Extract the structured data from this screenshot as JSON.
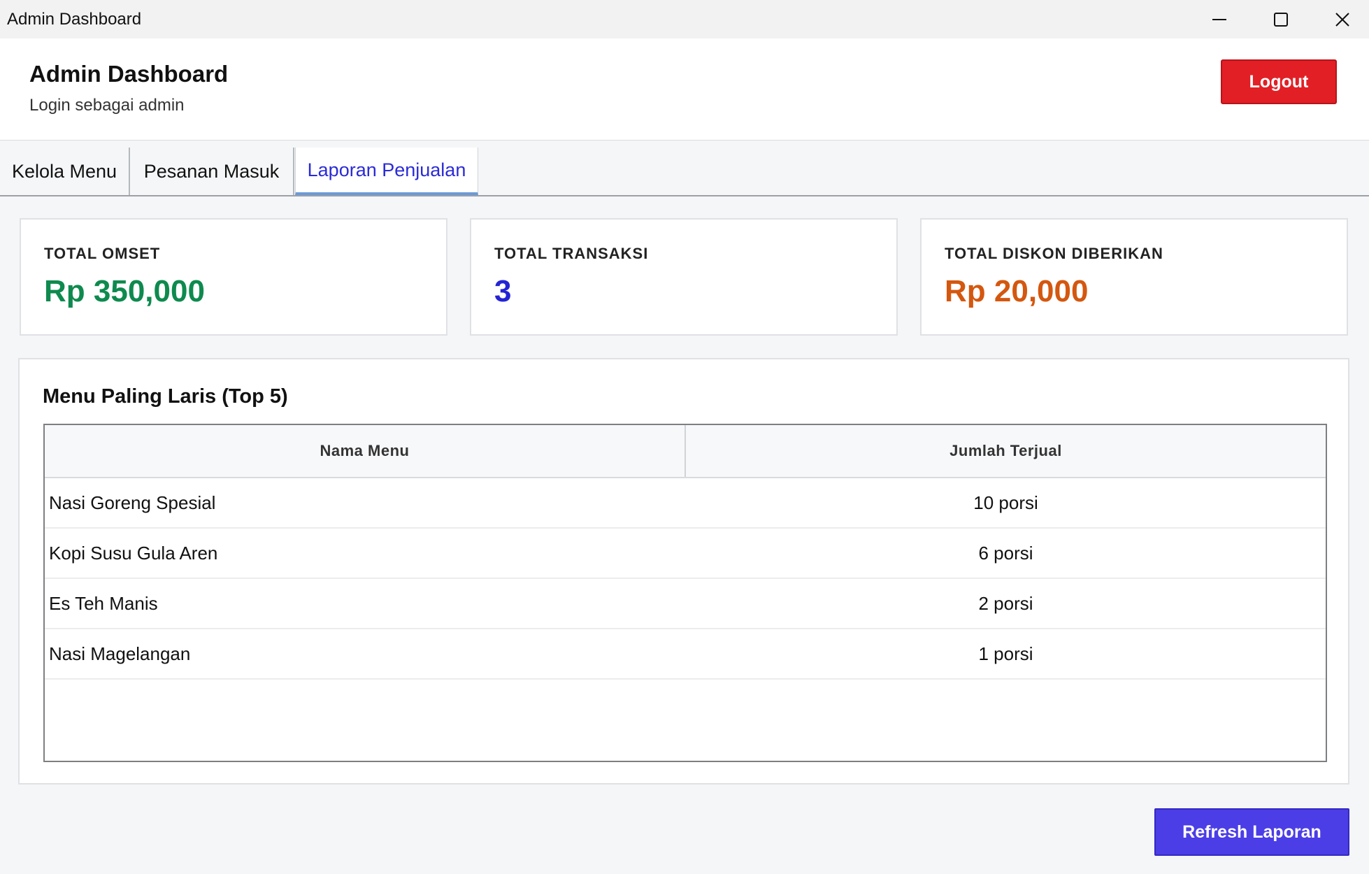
{
  "window": {
    "title": "Admin Dashboard"
  },
  "header": {
    "title": "Admin Dashboard",
    "subtitle": "Login sebagai admin",
    "logout_label": "Logout"
  },
  "tabs": [
    {
      "label": "Kelola Menu",
      "active": false
    },
    {
      "label": "Pesanan Masuk",
      "active": false
    },
    {
      "label": "Laporan Penjualan",
      "active": true
    }
  ],
  "stats": [
    {
      "label": "TOTAL OMSET",
      "value": "Rp 350,000",
      "color": "#0e8a4e"
    },
    {
      "label": "TOTAL TRANSAKSI",
      "value": "3",
      "color": "#2424d4"
    },
    {
      "label": "TOTAL DISKON DIBERIKAN",
      "value": "Rp 20,000",
      "color": "#d4570f"
    }
  ],
  "top_menu": {
    "title": "Menu Paling Laris (Top 5)",
    "columns": [
      "Nama Menu",
      "Jumlah Terjual"
    ],
    "rows": [
      {
        "name": "Nasi Goreng Spesial",
        "qty": "10 porsi"
      },
      {
        "name": "Kopi Susu Gula Aren",
        "qty": "6 porsi"
      },
      {
        "name": "Es Teh Manis",
        "qty": "2 porsi"
      },
      {
        "name": "Nasi Magelangan",
        "qty": "1 porsi"
      }
    ]
  },
  "footer": {
    "refresh_label": "Refresh Laporan"
  },
  "colors": {
    "logout": "#e21f25",
    "refresh": "#4b3ee6",
    "active_tab": "#2b2bd6"
  }
}
